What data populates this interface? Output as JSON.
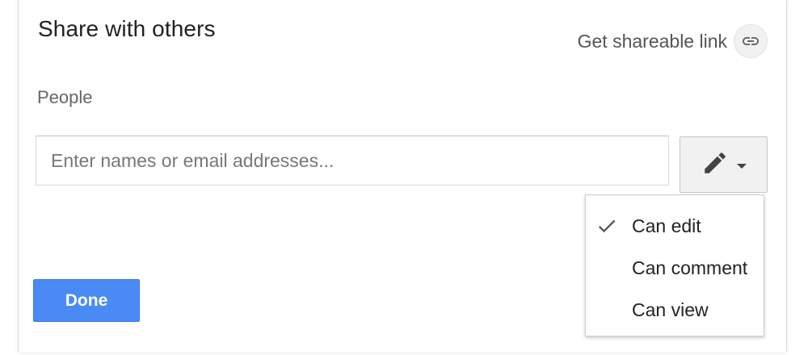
{
  "dialog": {
    "title": "Share with others",
    "shareable_link_label": "Get shareable link",
    "link_icon": "link-icon",
    "people_label": "People",
    "people_input": {
      "placeholder": "Enter names or email addresses...",
      "value": ""
    },
    "permission_button": {
      "icon": "pencil-icon",
      "caret_icon": "caret-down-icon"
    },
    "done_label": "Done",
    "accent_color": "#4a8af4"
  },
  "permission_menu": {
    "items": [
      {
        "label": "Can edit",
        "checked": true
      },
      {
        "label": "Can comment",
        "checked": false
      },
      {
        "label": "Can view",
        "checked": false
      }
    ]
  }
}
